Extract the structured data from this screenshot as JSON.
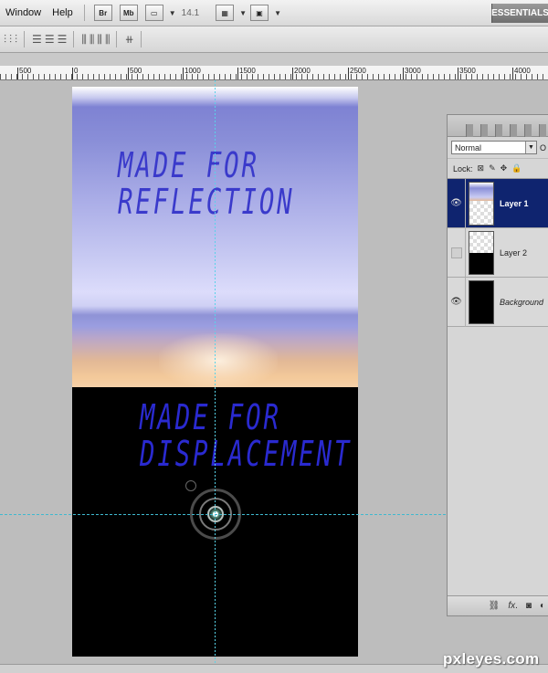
{
  "menu": {
    "items": [
      "Window",
      "Help"
    ]
  },
  "toolbar": {
    "bridge_label": "Br",
    "minibridge_label": "Mb",
    "zoom_value": "14.1",
    "workspace_label": "ESSENTIALS"
  },
  "ruler": {
    "labels": [
      {
        "text": "500"
      },
      {
        "text": "0"
      },
      {
        "text": "500"
      },
      {
        "text": "1000"
      },
      {
        "text": "1500"
      },
      {
        "text": "2000"
      },
      {
        "text": "2500"
      },
      {
        "text": "3000"
      },
      {
        "text": "3500"
      },
      {
        "text": "4000"
      }
    ]
  },
  "canvas": {
    "top_text_line1": "MADE FOR",
    "top_text_line2": "REFLECTION",
    "bottom_text_line1": "MADE FOR",
    "bottom_text_line2": "DISPLACEMENT"
  },
  "layers_panel": {
    "blend_mode": "Normal",
    "opacity_truncated": "O",
    "lock_label": "Lock:",
    "layers": [
      {
        "name": "Layer 1",
        "visible": true,
        "selected": true
      },
      {
        "name": "Layer 2",
        "visible": false,
        "selected": false
      },
      {
        "name": "Background",
        "visible": true,
        "selected": false
      }
    ]
  },
  "watermark": "pxleyes.com",
  "colors": {
    "selection": "#0f246f",
    "guide": "#58d3e8",
    "canvas_text": "#3a3acb"
  }
}
